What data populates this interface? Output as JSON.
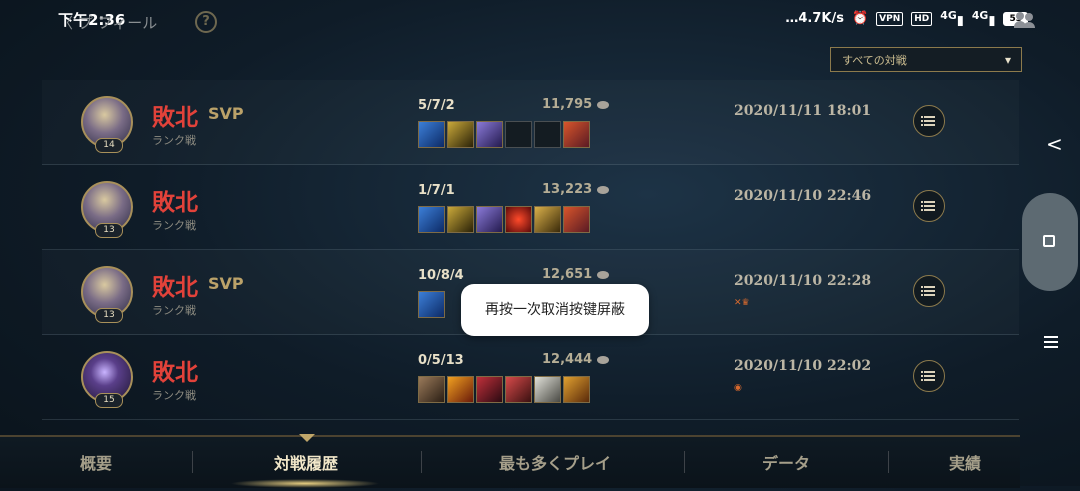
{
  "status_bar": {
    "time": "下午2:36",
    "speed": "…4.7K/s",
    "vpn": "VPN",
    "hd": "HD",
    "network_1": "4G",
    "network_2": "4G",
    "battery": "53"
  },
  "header": {
    "back_label": "〈 プ フィール",
    "help_glyph": "?"
  },
  "filter": {
    "label": "すべての対戦",
    "chevron": "▾"
  },
  "matches": [
    {
      "level": "14",
      "result": "敗北",
      "svp": "SVP",
      "mode": "ランク戦",
      "kda": "5/7/2",
      "gold": "11,795",
      "date": "2020/11/11 18:01",
      "extra": "",
      "items": [
        "blue-blade",
        "triangle-shield",
        "purple-sword",
        "empty",
        "empty",
        "monster-red"
      ]
    },
    {
      "level": "13",
      "result": "敗北",
      "svp": "",
      "mode": "ランク戦",
      "kda": "1/7/1",
      "gold": "13,223",
      "date": "2020/11/10 22:46",
      "extra": "",
      "items": [
        "blue-blade",
        "triangle-shield",
        "purple-sword",
        "red-orb",
        "gold-armor",
        "monster-red"
      ]
    },
    {
      "level": "13",
      "result": "敗北",
      "svp": "SVP",
      "mode": "ランク戦",
      "kda": "10/8/4",
      "gold": "12,651",
      "date": "2020/11/10 22:28",
      "extra": "✕♛",
      "items": [
        "blue-blade",
        "empty",
        "empty",
        "empty",
        "empty",
        "empty"
      ]
    },
    {
      "level": "15",
      "result": "敗北",
      "svp": "",
      "mode": "ランク戦",
      "kda": "0/5/13",
      "gold": "12,444",
      "date": "2020/11/10 22:02",
      "extra": "◉",
      "items": [
        "brown-shield",
        "fire-crest",
        "red-fist",
        "red-sword",
        "white-boots",
        "gold-mask"
      ]
    }
  ],
  "toast": {
    "message": "再按一次取消按键屏蔽"
  },
  "tabs": [
    {
      "label": "概要",
      "active": false
    },
    {
      "label": "対戦履歴",
      "active": true
    },
    {
      "label": "最も多くプレイ",
      "active": false
    },
    {
      "label": "データ",
      "active": false
    },
    {
      "label": "実績",
      "active": false
    }
  ],
  "colors": {
    "defeat": "#e2423a",
    "gold_accent": "#bba269",
    "background": "#13222f"
  }
}
